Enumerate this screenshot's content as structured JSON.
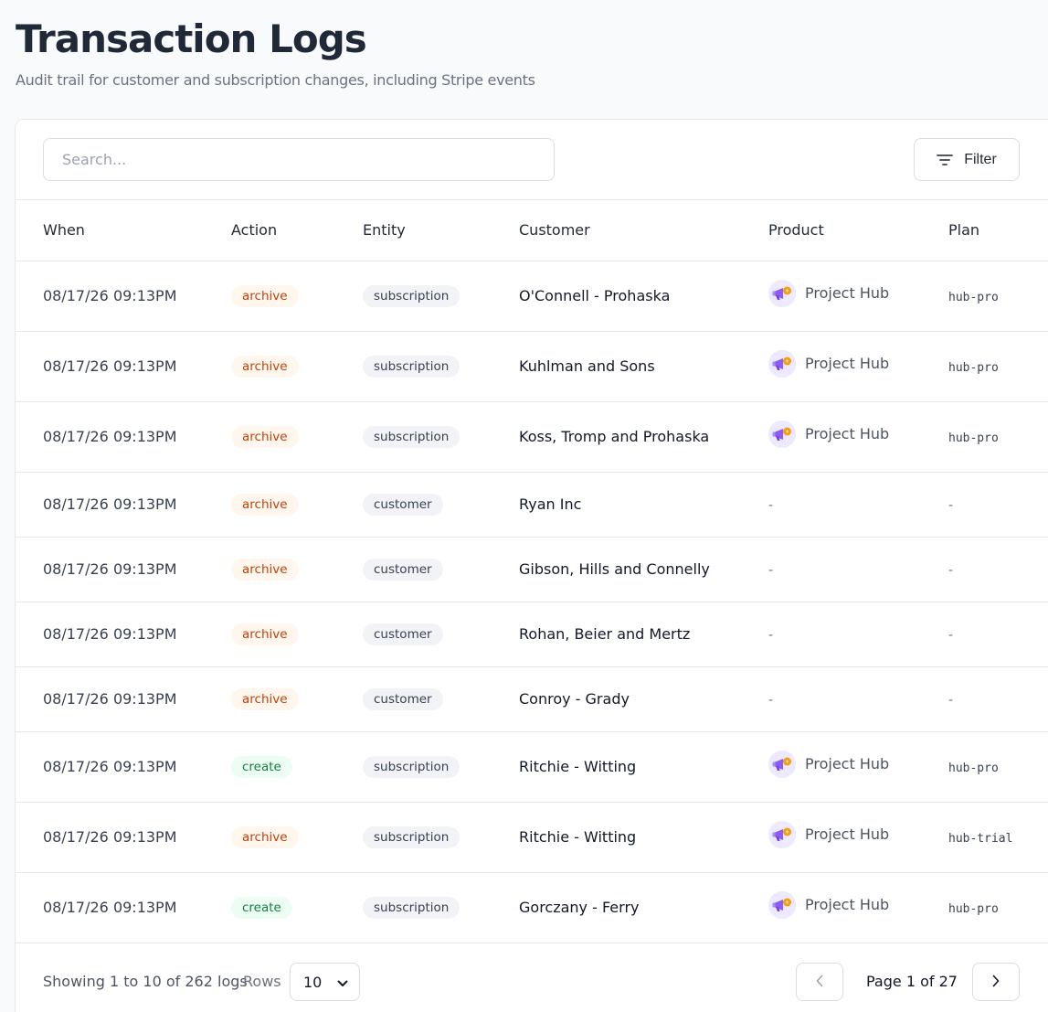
{
  "header": {
    "title": "Transaction Logs",
    "subtitle": "Audit trail for customer and subscription changes, including Stripe events"
  },
  "toolbar": {
    "search_placeholder": "Search...",
    "filter_label": "Filter",
    "filter_icon": "filter-lines-icon"
  },
  "table": {
    "columns": [
      "When",
      "Action",
      "Entity",
      "Customer",
      "Product",
      "Plan"
    ],
    "rows": [
      {
        "when": "08/17/26 09:13PM",
        "action": "archive",
        "entity": "subscription",
        "customer": "O'Connell - Prohaska",
        "product": "Project Hub",
        "plan": "hub-pro"
      },
      {
        "when": "08/17/26 09:13PM",
        "action": "archive",
        "entity": "subscription",
        "customer": "Kuhlman and Sons",
        "product": "Project Hub",
        "plan": "hub-pro"
      },
      {
        "when": "08/17/26 09:13PM",
        "action": "archive",
        "entity": "subscription",
        "customer": "Koss, Tromp and Prohaska",
        "product": "Project Hub",
        "plan": "hub-pro"
      },
      {
        "when": "08/17/26 09:13PM",
        "action": "archive",
        "entity": "customer",
        "customer": "Ryan Inc",
        "product": "-",
        "plan": "-"
      },
      {
        "when": "08/17/26 09:13PM",
        "action": "archive",
        "entity": "customer",
        "customer": "Gibson, Hills and Connelly",
        "product": "-",
        "plan": "-"
      },
      {
        "when": "08/17/26 09:13PM",
        "action": "archive",
        "entity": "customer",
        "customer": "Rohan, Beier and Mertz",
        "product": "-",
        "plan": "-"
      },
      {
        "when": "08/17/26 09:13PM",
        "action": "archive",
        "entity": "customer",
        "customer": "Conroy - Grady",
        "product": "-",
        "plan": "-"
      },
      {
        "when": "08/17/26 09:13PM",
        "action": "create",
        "entity": "subscription",
        "customer": "Ritchie - Witting",
        "product": "Project Hub",
        "plan": "hub-pro"
      },
      {
        "when": "08/17/26 09:13PM",
        "action": "archive",
        "entity": "subscription",
        "customer": "Ritchie - Witting",
        "product": "Project Hub",
        "plan": "hub-trial"
      },
      {
        "when": "08/17/26 09:13PM",
        "action": "create",
        "entity": "subscription",
        "customer": "Gorczany - Ferry",
        "product": "Project Hub",
        "plan": "hub-pro"
      }
    ]
  },
  "footer": {
    "showing": "Showing 1 to 10 of 262 logs",
    "rows_label": "Rows",
    "rows_value": "10",
    "page_label": "Page 1 of 27"
  },
  "colors": {
    "archive_badge_bg": "#fff7ed",
    "archive_badge_text": "#c2410c",
    "create_badge_bg": "#ecfdf3",
    "create_badge_text": "#15803d",
    "product_icon": "#8b5cf6"
  }
}
